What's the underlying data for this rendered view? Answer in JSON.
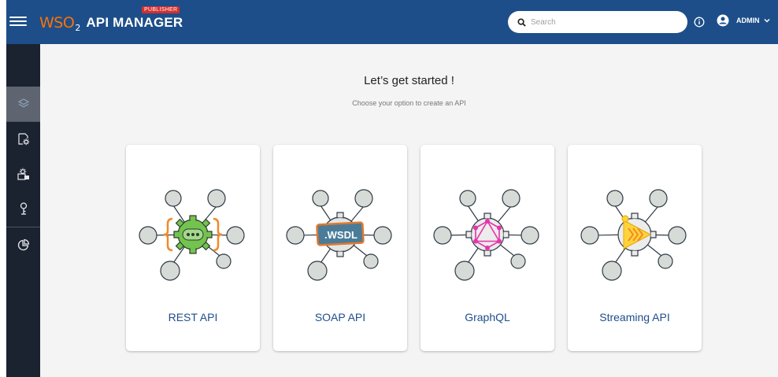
{
  "header": {
    "logo_brand_w": "W",
    "logo_brand_so": "SO",
    "logo_brand_sub": "2",
    "logo_product": "API MANAGER",
    "badge": "PUBLISHER",
    "search_placeholder": "Search",
    "user": "ADMIN",
    "color": "#1d4e89"
  },
  "sidebar": {
    "items": [
      {
        "icon": "layers-icon",
        "active": true
      },
      {
        "icon": "api-settings-icon"
      },
      {
        "icon": "applications-icon"
      },
      {
        "icon": "key-icon"
      },
      {
        "icon": "analytics-pie-icon"
      }
    ]
  },
  "main": {
    "title": "Let’s get started !",
    "subtitle": "Choose your option to create an API",
    "cards": [
      {
        "label": "REST API",
        "icon": "rest-api-icon"
      },
      {
        "label": "SOAP API",
        "icon": "soap-wsdl-icon",
        "badge_text": ".WSDL"
      },
      {
        "label": "GraphQL",
        "icon": "graphql-icon"
      },
      {
        "label": "Streaming API",
        "icon": "streaming-api-icon"
      }
    ]
  }
}
